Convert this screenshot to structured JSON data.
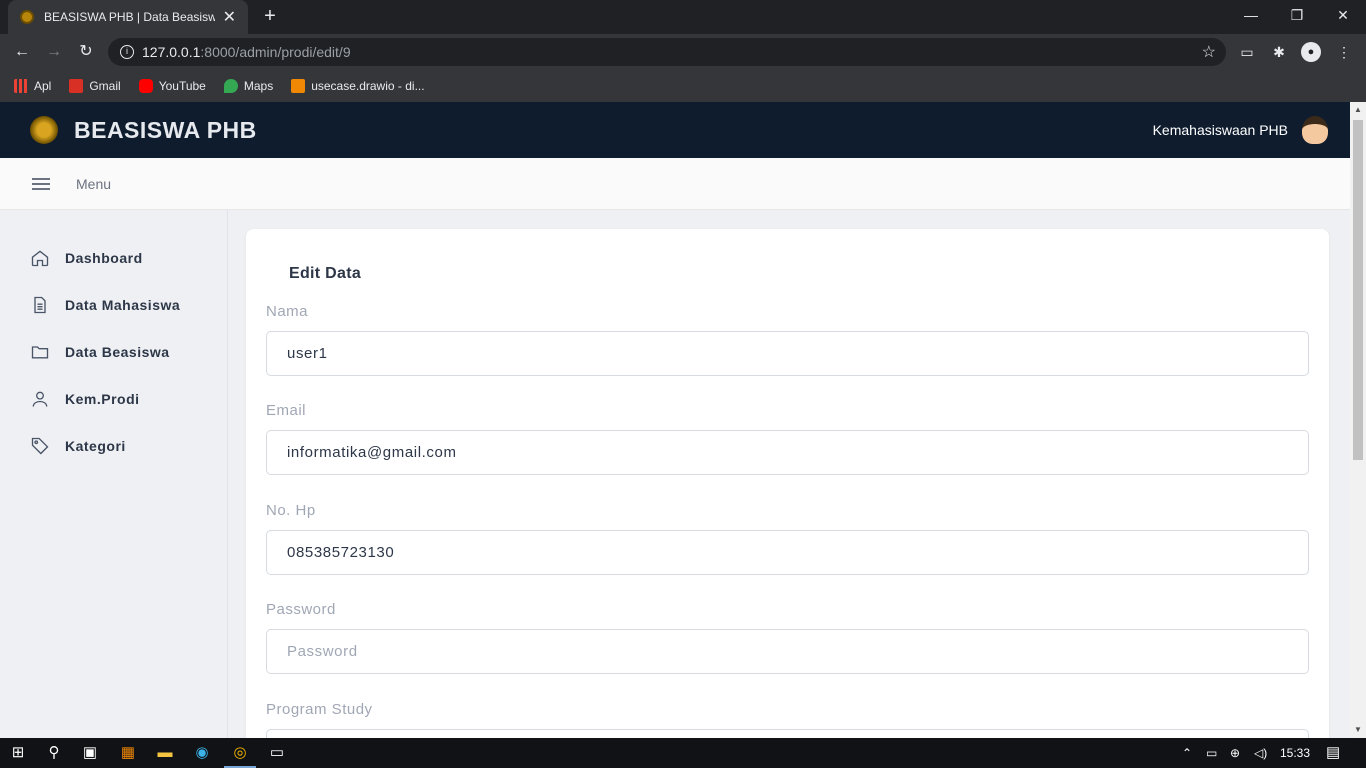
{
  "browser": {
    "tab_title": "BEASISWA PHB | Data Beasiswa",
    "url_host": "127.0.0.1",
    "url_rest": ":8000/admin/prodi/edit/9",
    "bookmarks": [
      {
        "label": "Apl",
        "color": "#ea4335"
      },
      {
        "label": "Gmail",
        "color": "#d93025"
      },
      {
        "label": "YouTube",
        "color": "#ff0000"
      },
      {
        "label": "Maps",
        "color": "#34a853"
      },
      {
        "label": "usecase.drawio - di...",
        "color": "#f08705"
      }
    ]
  },
  "header": {
    "brand": "BEASISWA PHB",
    "user_name": "Kemahasiswaan PHB"
  },
  "menubar": {
    "label": "Menu"
  },
  "sidebar": {
    "items": [
      {
        "label": "Dashboard",
        "icon": "home-icon"
      },
      {
        "label": "Data Mahasiswa",
        "icon": "document-icon"
      },
      {
        "label": "Data Beasiswa",
        "icon": "folder-icon"
      },
      {
        "label": "Kem.Prodi",
        "icon": "user-icon"
      },
      {
        "label": "Kategori",
        "icon": "tag-icon"
      }
    ]
  },
  "form": {
    "title": "Edit Data",
    "fields": [
      {
        "label": "Nama",
        "value": "user1",
        "placeholder": ""
      },
      {
        "label": "Email",
        "value": "informatika@gmail.com",
        "placeholder": ""
      },
      {
        "label": "No. Hp",
        "value": "085385723130",
        "placeholder": ""
      },
      {
        "label": "Password",
        "value": "",
        "placeholder": "Password"
      },
      {
        "label": "Program Study",
        "value": "",
        "placeholder": ""
      }
    ]
  },
  "taskbar": {
    "time": "15:33"
  },
  "colors": {
    "header_bg": "#0f1c2e",
    "page_bg": "#eef0f3",
    "card_bg": "#ffffff"
  }
}
